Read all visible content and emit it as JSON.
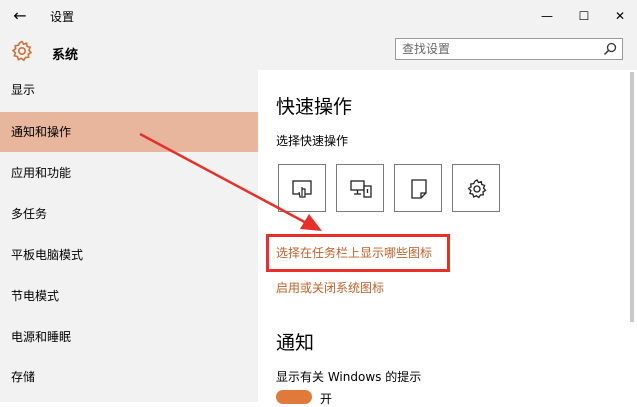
{
  "window": {
    "title": "设置",
    "buttons": {
      "minimize": "—",
      "maximize": "☐",
      "close": "✕"
    },
    "back_icon": "back-arrow-icon"
  },
  "header": {
    "icon": "gear-icon",
    "title": "系统",
    "search": {
      "placeholder": "查找设置",
      "value": "",
      "icon": "search-icon"
    }
  },
  "sidebar": {
    "items": [
      {
        "label": "显示",
        "active": false
      },
      {
        "label": "通知和操作",
        "active": true
      },
      {
        "label": "应用和功能",
        "active": false
      },
      {
        "label": "多任务",
        "active": false
      },
      {
        "label": "平板电脑模式",
        "active": false
      },
      {
        "label": "节电模式",
        "active": false
      },
      {
        "label": "电源和睡眠",
        "active": false
      },
      {
        "label": "存储",
        "active": false
      }
    ]
  },
  "main": {
    "quick_actions": {
      "heading": "快速操作",
      "subheading": "选择快速操作",
      "tiles": [
        {
          "icon": "tablet-touch-icon"
        },
        {
          "icon": "project-display-icon"
        },
        {
          "icon": "note-icon"
        },
        {
          "icon": "gear-icon"
        }
      ],
      "links": {
        "taskbar_icons": "选择在任务栏上显示哪些图标",
        "system_icons": "启用或关闭系统图标"
      }
    },
    "notifications": {
      "heading": "通知",
      "tip_label": "显示有关 Windows 的提示",
      "toggle_state": "开"
    }
  },
  "colors": {
    "accent": "#c0612b",
    "sidebar_active": "#e8b69d",
    "annotation_red": "#e8302a",
    "toggle_on": "#e07a3a"
  }
}
